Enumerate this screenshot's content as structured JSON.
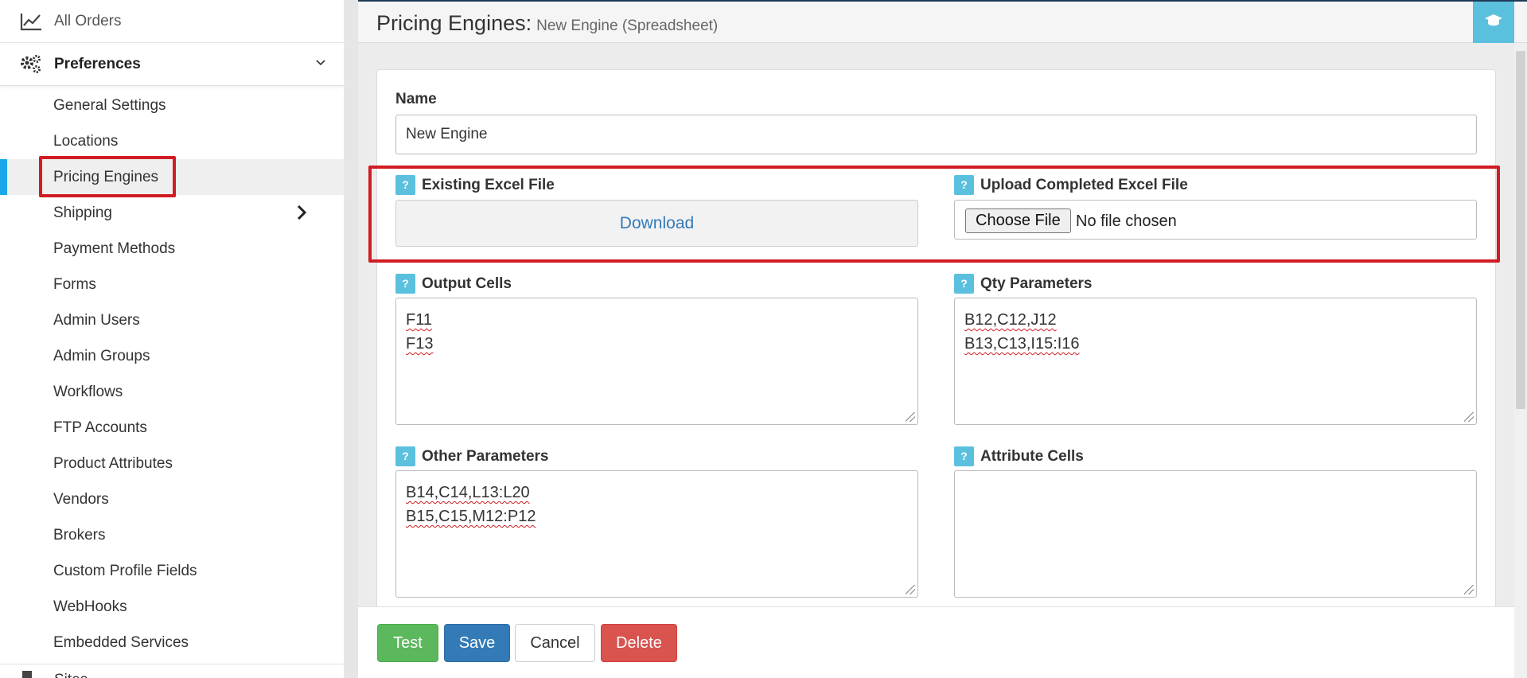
{
  "sidebar": {
    "all_orders": "All Orders",
    "preferences": "Preferences",
    "items": [
      {
        "label": "General Settings"
      },
      {
        "label": "Locations"
      },
      {
        "label": "Pricing Engines"
      },
      {
        "label": "Shipping"
      },
      {
        "label": "Payment Methods"
      },
      {
        "label": "Forms"
      },
      {
        "label": "Admin Users"
      },
      {
        "label": "Admin Groups"
      },
      {
        "label": "Workflows"
      },
      {
        "label": "FTP Accounts"
      },
      {
        "label": "Product Attributes"
      },
      {
        "label": "Vendors"
      },
      {
        "label": "Brokers"
      },
      {
        "label": "Custom Profile Fields"
      },
      {
        "label": "WebHooks"
      },
      {
        "label": "Embedded Services"
      }
    ],
    "sites": "Sites",
    "active_item": "Pricing Engines"
  },
  "header": {
    "title": "Pricing Engines:",
    "subtitle": "New Engine (Spreadsheet)"
  },
  "form": {
    "name_label": "Name",
    "name_value": "New Engine",
    "existing_label": "Existing Excel File",
    "download_label": "Download",
    "upload_label": "Upload Completed Excel File",
    "choose_file": "Choose File",
    "no_file": "No file chosen",
    "output_label": "Output Cells",
    "output_lines": [
      "F11",
      "F13"
    ],
    "qty_label": "Qty Parameters",
    "qty_lines": [
      "B12,C12,J12",
      "B13,C13,I15:I16"
    ],
    "other_label": "Other Parameters",
    "other_lines": [
      "B14,C14,L13:L20",
      "B15,C15,M12:P12"
    ],
    "attr_label": "Attribute Cells",
    "help_glyph": "?"
  },
  "buttons": {
    "test": "Test",
    "save": "Save",
    "cancel": "Cancel",
    "delete": "Delete"
  },
  "colors": {
    "accent": "#19a7e8",
    "help": "#5bc0de",
    "highlight": "#d01c22",
    "test": "#5cb85c",
    "save": "#337ab7",
    "delete": "#d9534f"
  }
}
